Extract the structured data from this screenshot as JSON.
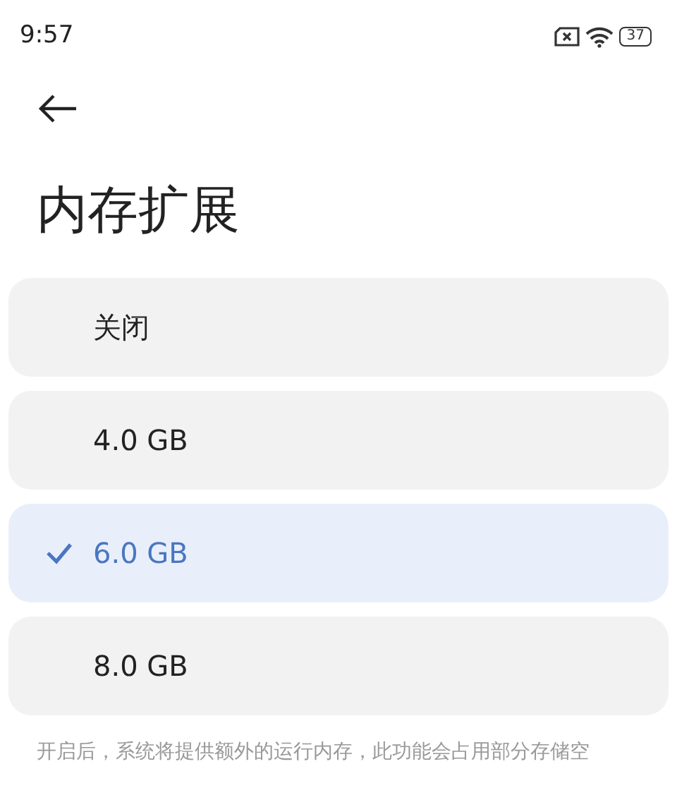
{
  "status_bar": {
    "time": "9:57",
    "battery": "37"
  },
  "title": "内存扩展",
  "options": [
    {
      "label": "关闭",
      "selected": false
    },
    {
      "label": "4.0 GB",
      "selected": false
    },
    {
      "label": "6.0 GB",
      "selected": true
    },
    {
      "label": "8.0 GB",
      "selected": false
    }
  ],
  "note": "开启后，系统将提供额外的运行内存，此功能会占用部分存储空"
}
